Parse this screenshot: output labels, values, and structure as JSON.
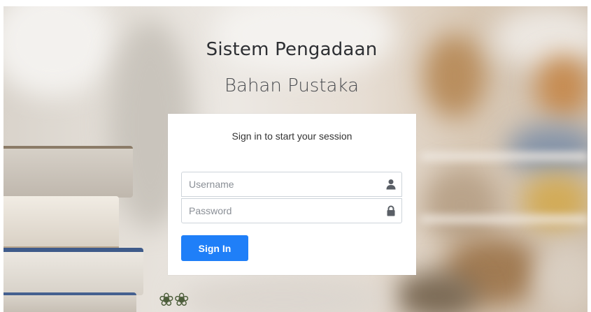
{
  "app": {
    "title_line1": "Sistem Pengadaan",
    "title_line2": "Bahan Pustaka"
  },
  "login": {
    "message": "Sign in to start your session",
    "username": {
      "placeholder": "Username",
      "value": "",
      "icon": "user-icon"
    },
    "password": {
      "placeholder": "Password",
      "value": "",
      "icon": "lock-icon"
    },
    "submit_label": "Sign In"
  },
  "colors": {
    "accent": "#1f7ff8",
    "card": "#ffffff",
    "title": "#2d2f33"
  }
}
